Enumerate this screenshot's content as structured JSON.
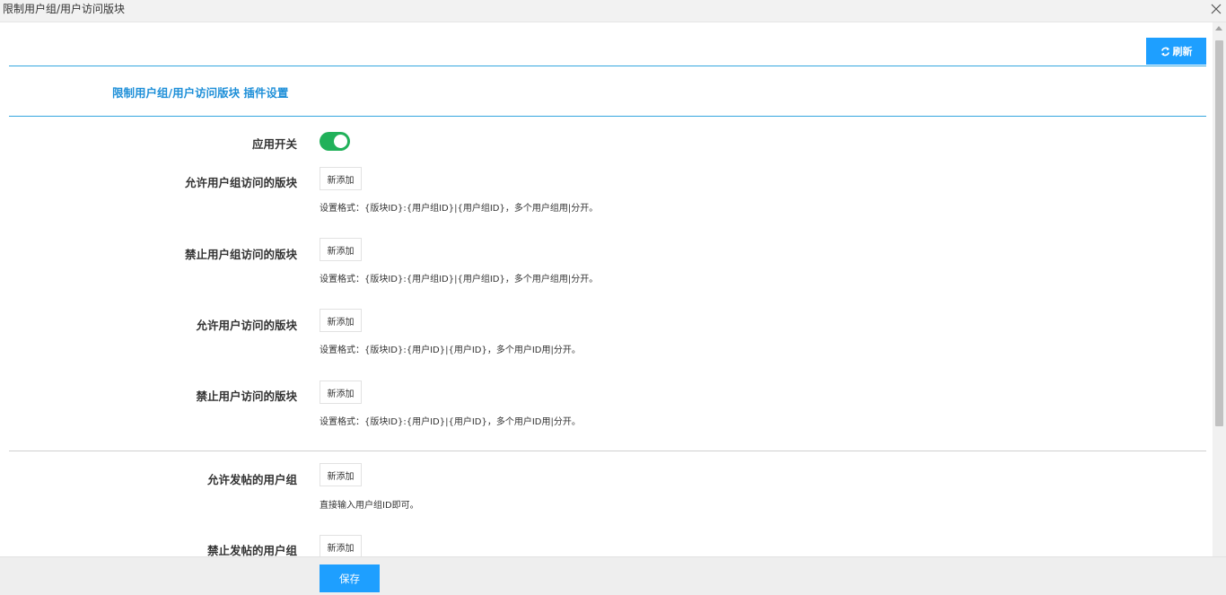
{
  "window": {
    "title": "限制用户组/用户访问版块"
  },
  "toolbar": {
    "refresh_label": "刷新"
  },
  "section": {
    "title": "限制用户组/用户访问版块 插件设置"
  },
  "switch": {
    "label": "应用开关",
    "state": "on"
  },
  "fields": [
    {
      "label": "允许用户组访问的版块",
      "button": "新添加",
      "hint": "设置格式：{版块ID}:{用户组ID}|{用户组ID}，多个用户组用|分开。"
    },
    {
      "label": "禁止用户组访问的版块",
      "button": "新添加",
      "hint": "设置格式：{版块ID}:{用户组ID}|{用户组ID}，多个用户组用|分开。"
    },
    {
      "label": "允许用户访问的版块",
      "button": "新添加",
      "hint": "设置格式：{版块ID}:{用户ID}|{用户ID}，多个用户ID用|分开。"
    },
    {
      "label": "禁止用户访问的版块",
      "button": "新添加",
      "hint": "设置格式：{版块ID}:{用户ID}|{用户ID}，多个用户ID用|分开。"
    },
    {
      "label": "允许发帖的用户组",
      "button": "新添加",
      "hint": "直接输入用户组ID即可。"
    },
    {
      "label": "禁止发帖的用户组",
      "button": "新添加"
    }
  ],
  "footer": {
    "save_label": "保存"
  },
  "colors": {
    "accent": "#1e9fff",
    "toggle_on": "#21b15a",
    "section_title": "#1e8fd8",
    "divider": "#35a6df"
  }
}
